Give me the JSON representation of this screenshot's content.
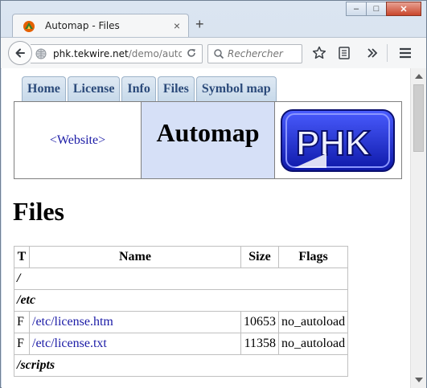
{
  "browser": {
    "tab_title": "Automap - Files",
    "tab_close": "×",
    "new_tab": "+",
    "url_host": "phk.tekwire.net",
    "url_path": "/demo/auto",
    "search_placeholder": "Rechercher",
    "window_controls": {
      "minimize": "–",
      "maximize": "□",
      "close": "✕"
    }
  },
  "site": {
    "tabs": [
      "Home",
      "License",
      "Info",
      "Files",
      "Symbol map"
    ],
    "banner_link": "<Website>",
    "banner_title": "Automap",
    "logo_text": "PHK"
  },
  "page": {
    "heading": "Files",
    "table": {
      "headers": [
        "T",
        "Name",
        "Size",
        "Flags"
      ],
      "rows": [
        {
          "kind": "dir",
          "name": "/"
        },
        {
          "kind": "dir",
          "name": "/etc"
        },
        {
          "kind": "file",
          "t": "F",
          "name": "/etc/license.htm",
          "size": "10653",
          "flags": "no_autoload"
        },
        {
          "kind": "file",
          "t": "F",
          "name": "/etc/license.txt",
          "size": "11358",
          "flags": "no_autoload"
        },
        {
          "kind": "dir",
          "name": "/scripts"
        }
      ]
    }
  },
  "colors": {
    "link": "#1a1aa6",
    "banner_title_bg": "#d6e0f7",
    "site_tab_text": "#2b4a7a",
    "logo_blue": "#1f2fd6"
  },
  "icons": [
    "firefox-favicon",
    "back-arrow-icon",
    "globe-icon",
    "reload-icon",
    "search-icon",
    "bookmark-star-icon",
    "reading-list-icon",
    "overflow-chevron-icon",
    "hamburger-menu-icon"
  ]
}
